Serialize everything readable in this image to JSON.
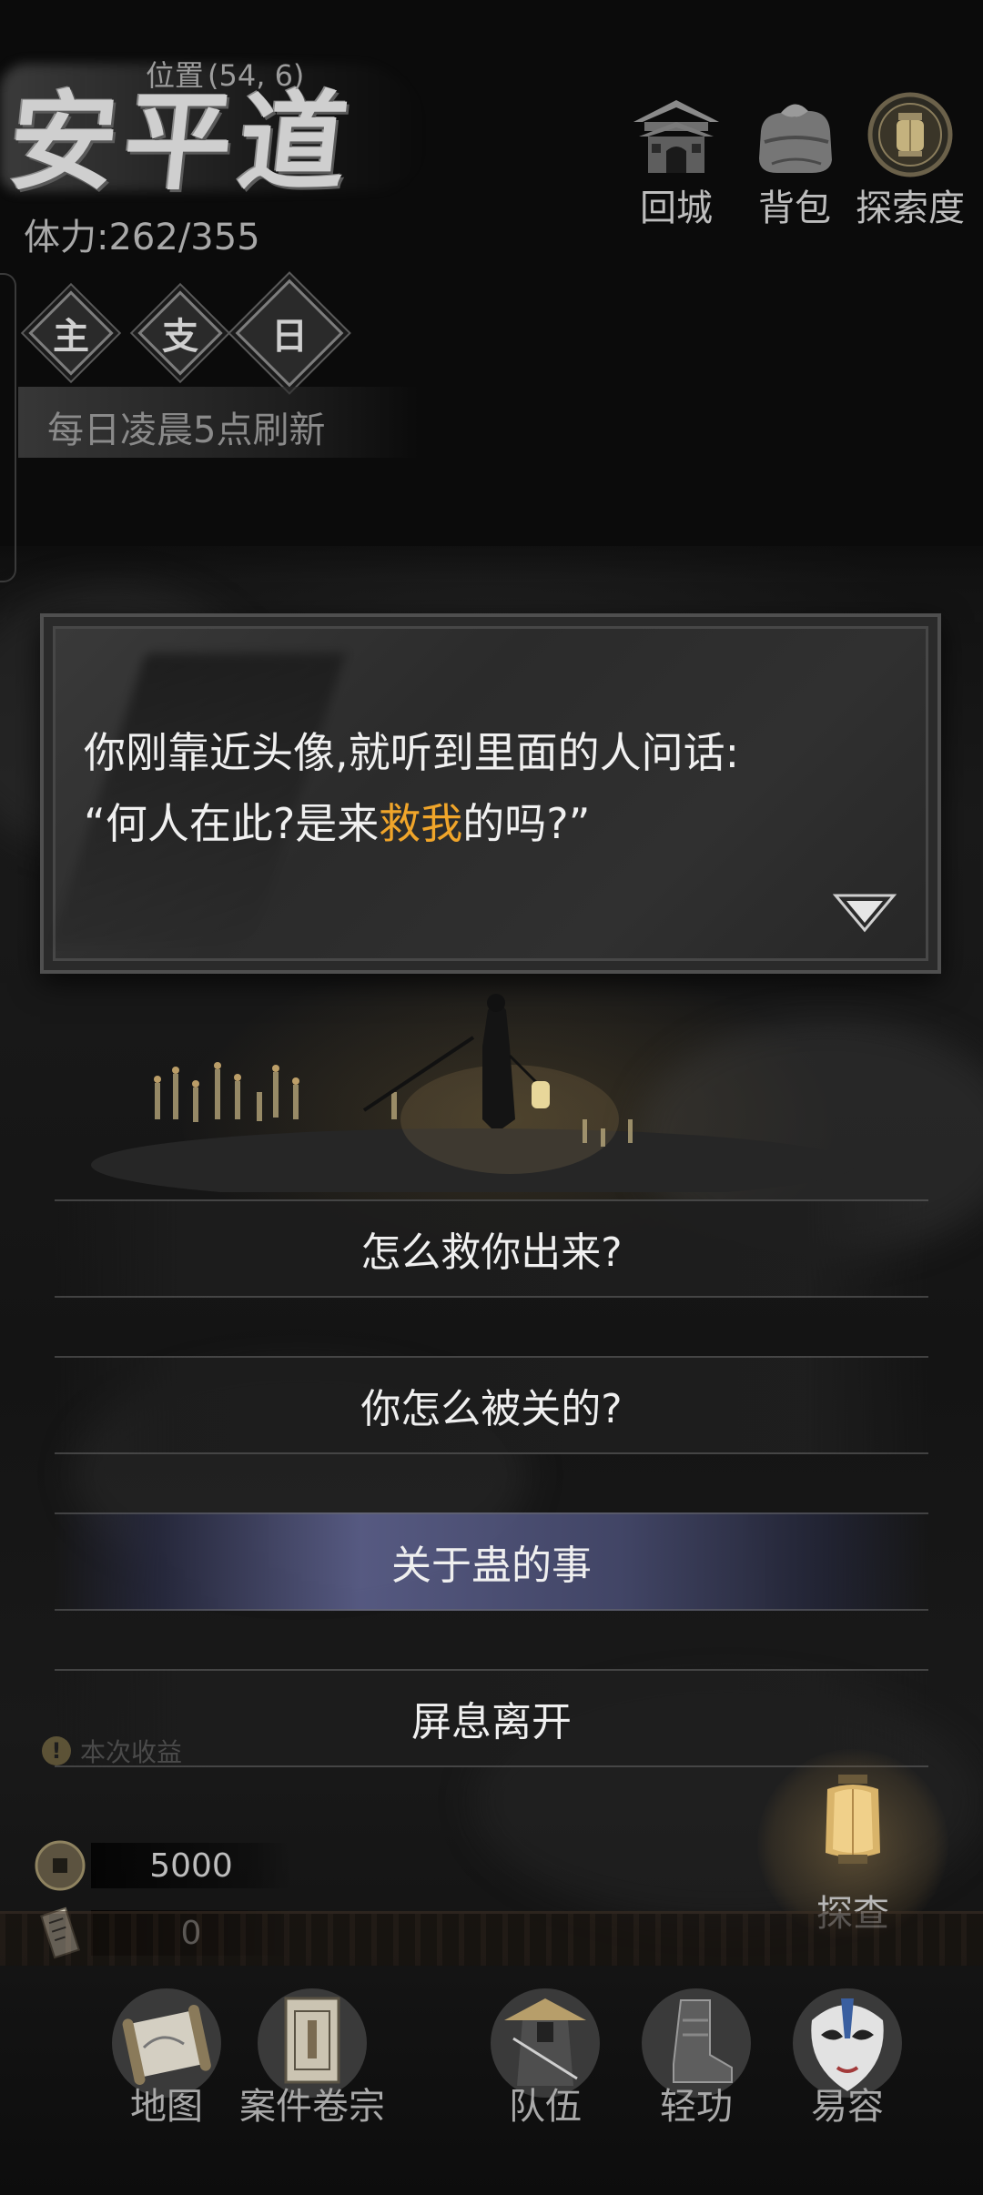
{
  "header": {
    "location_name": "安平道",
    "coord_label": "位置",
    "coord_value": "(54, 6)",
    "stamina_label": "体力:",
    "stamina_value": "262/355",
    "buttons": [
      {
        "label": "回城",
        "icon": "city-gate-icon"
      },
      {
        "label": "背包",
        "icon": "bundle-icon"
      },
      {
        "label": "探索度",
        "icon": "lantern-medallion-icon"
      }
    ]
  },
  "tasks": {
    "badges": [
      "主",
      "支",
      "日"
    ],
    "refresh_note": "每日凌晨5点刷新"
  },
  "dialog": {
    "line1": "你刚靠近头像,就听到里面的人问话:",
    "line2_before": "“何人在此?是来",
    "line2_highlight": "救我",
    "line2_after": "的吗?”",
    "highlight_color": "#f0a52a"
  },
  "choices": [
    {
      "label": "怎么救你出来?",
      "active": false
    },
    {
      "label": "你怎么被关的?",
      "active": false
    },
    {
      "label": "关于蛊的事",
      "active": true
    },
    {
      "label": "屏息离开",
      "active": false
    }
  ],
  "hint": {
    "icon": "warning-icon",
    "icon_glyph": "!",
    "text": "本次收益"
  },
  "currency": {
    "coins": "5000",
    "tokens": "0"
  },
  "explore_button": {
    "label": "探查"
  },
  "bottom_nav": [
    {
      "label": "地图",
      "icon": "scroll-map-icon"
    },
    {
      "label": "案件卷宗",
      "icon": "case-file-icon"
    },
    {
      "label": "队伍",
      "icon": "straw-hat-swordsman-icon"
    },
    {
      "label": "轻功",
      "icon": "boot-icon"
    },
    {
      "label": "易容",
      "icon": "opera-mask-icon"
    }
  ]
}
